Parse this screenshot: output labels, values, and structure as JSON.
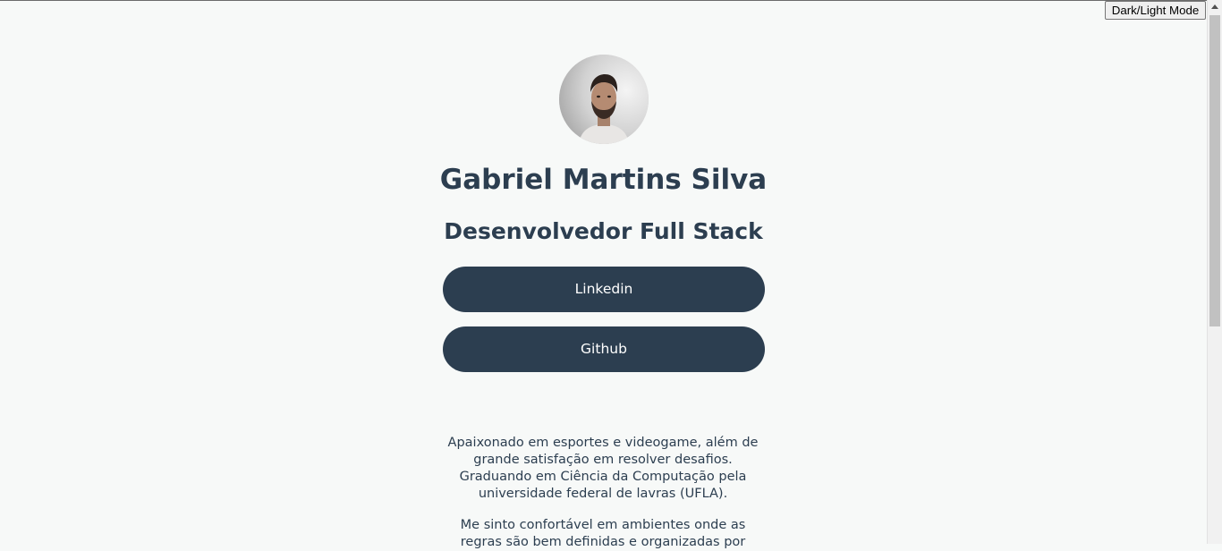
{
  "header": {
    "mode_toggle_label": "Dark/Light Mode"
  },
  "profile": {
    "name": "Gabriel Martins Silva",
    "role": "Desenvolvedor Full Stack",
    "avatar_alt": "Profile photo"
  },
  "links": [
    {
      "label": "Linkedin"
    },
    {
      "label": "Github"
    }
  ],
  "about": {
    "paragraph_1": "Apaixonado em esportes e videogame, além de grande satisfação em resolver desafios. Graduando em Ciência da Computação pela universidade federal de lavras (UFLA).",
    "paragraph_2": "Me sinto confortável em ambientes onde as regras são bem definidas e organizadas por"
  },
  "colors": {
    "background": "#f7f9f8",
    "primary": "#2c3e50",
    "button_text": "#ffffff"
  }
}
